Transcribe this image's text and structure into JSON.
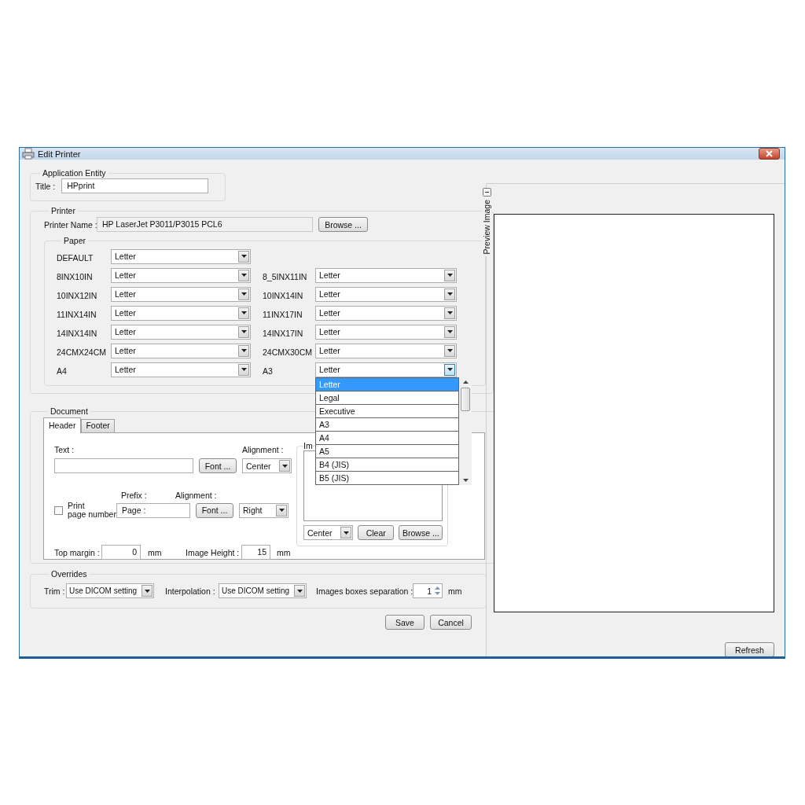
{
  "window": {
    "title": "Edit Printer"
  },
  "application_entity": {
    "legend": "Application Entity",
    "title_label": "Title :",
    "title_value": "HPprint"
  },
  "printer": {
    "legend": "Printer",
    "name_label": "Printer Name :",
    "name_value": "HP LaserJet P3011/P3015 PCL6",
    "browse_button": "Browse ...",
    "paper": {
      "legend": "Paper",
      "rows": [
        [
          {
            "label": "DEFAULT",
            "value": "Letter",
            "open": false
          }
        ],
        [
          {
            "label": "8INX10IN",
            "value": "Letter",
            "open": false
          },
          {
            "label": "8_5INX11IN",
            "value": "Letter",
            "open": false
          }
        ],
        [
          {
            "label": "10INX12IN",
            "value": "Letter",
            "open": false
          },
          {
            "label": "10INX14IN",
            "value": "Letter",
            "open": false
          }
        ],
        [
          {
            "label": "11INX14IN",
            "value": "Letter",
            "open": false
          },
          {
            "label": "11INX17IN",
            "value": "Letter",
            "open": false
          }
        ],
        [
          {
            "label": "14INX14IN",
            "value": "Letter",
            "open": false
          },
          {
            "label": "14INX17IN",
            "value": "Letter",
            "open": false
          }
        ],
        [
          {
            "label": "24CMX24CM",
            "value": "Letter",
            "open": false
          },
          {
            "label": "24CMX30CM",
            "value": "Letter",
            "open": false
          }
        ],
        [
          {
            "label": "A4",
            "value": "Letter",
            "open": false
          },
          {
            "label": "A3",
            "value": "Letter",
            "open": true
          }
        ]
      ]
    }
  },
  "dropdown_options": [
    {
      "label": "Letter",
      "selected": true
    },
    {
      "label": "Legal",
      "selected": false
    },
    {
      "label": "Executive",
      "selected": false
    },
    {
      "label": "A3",
      "selected": false
    },
    {
      "label": "A4",
      "selected": false
    },
    {
      "label": "A5",
      "selected": false
    },
    {
      "label": "B4 (JIS)",
      "selected": false
    },
    {
      "label": "B5 (JIS)",
      "selected": false
    }
  ],
  "document": {
    "legend": "Document",
    "tabs": [
      {
        "label": "Header",
        "selected": true
      },
      {
        "label": "Footer",
        "selected": false
      }
    ],
    "text_label": "Text :",
    "font_button": "Font ...",
    "alignment_label": "Alignment :",
    "alignment_value": "Center",
    "print_page_number": {
      "label_lines": [
        "Print",
        "page number"
      ],
      "checked": false
    },
    "prefix_label": "Prefix :",
    "prefix_value": "Page :",
    "prefix_font_button": "Font ...",
    "prefix_alignment_label": "Alignment :",
    "prefix_alignment_value": "Right",
    "top_margin_label": "Top margin :",
    "top_margin_value": "0",
    "top_margin_unit": "mm",
    "image_height_label": "Image Height :",
    "image_height_value": "15",
    "image_height_unit": "mm",
    "image_group": {
      "legend": "Im",
      "alignment_value": "Center",
      "clear_button": "Clear",
      "browse_button": "Browse ..."
    }
  },
  "overrides": {
    "legend": "Overrides",
    "trim_label": "Trim :",
    "trim_value": "Use DICOM setting",
    "interpolation_label": "Interpolation :",
    "interpolation_value": "Use DICOM setting",
    "separation_label": "Images boxes separation :",
    "separation_value": "1",
    "separation_unit": "mm"
  },
  "buttons": [
    {
      "label": "Save"
    },
    {
      "label": "Cancel"
    }
  ],
  "preview": {
    "legend": "Preview Image",
    "refresh_button": "Refresh"
  }
}
